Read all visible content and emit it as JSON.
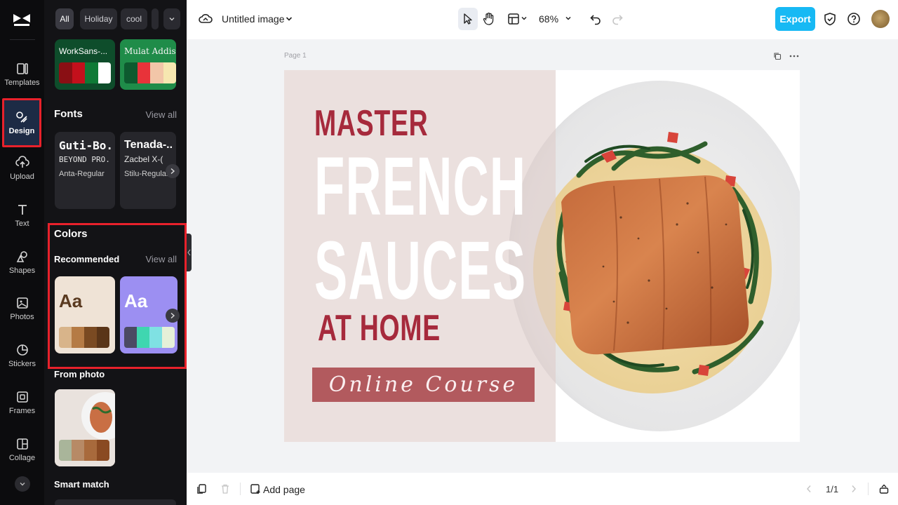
{
  "rail": {
    "items": [
      {
        "label": "Templates",
        "icon": "templates-icon"
      },
      {
        "label": "Design",
        "icon": "design-icon",
        "active": true
      },
      {
        "label": "Upload",
        "icon": "upload-icon"
      },
      {
        "label": "Text",
        "icon": "text-icon"
      },
      {
        "label": "Shapes",
        "icon": "shapes-icon"
      },
      {
        "label": "Photos",
        "icon": "photos-icon"
      },
      {
        "label": "Stickers",
        "icon": "stickers-icon"
      },
      {
        "label": "Frames",
        "icon": "frames-icon"
      },
      {
        "label": "Collage",
        "icon": "collage-icon"
      }
    ]
  },
  "panel": {
    "chips": [
      "All",
      "Holiday",
      "cool"
    ],
    "theme_cards": [
      {
        "font": "WorkSans-...",
        "bg": "#0e4d2b",
        "swatches": [
          "#8a0f14",
          "#c3101c",
          "#0f7a36",
          "#ffffff"
        ]
      },
      {
        "font": "Mulat Addis-...",
        "bg": "#1f8c49",
        "swatches": [
          "#0d5a2f",
          "#e8333a",
          "#f2c6a8",
          "#f6e7b0"
        ]
      }
    ],
    "fonts": {
      "title": "Fonts",
      "view_all": "View all",
      "cards": [
        {
          "big": "Guti-Bo...",
          "mid": "BEYOND PRO...",
          "small": "Anta-Regular"
        },
        {
          "big": "Tenada-...",
          "mid": "Zacbel X-(",
          "small": "Stilu-Regular"
        }
      ]
    },
    "colors": {
      "title": "Colors",
      "recommended": "Recommended",
      "view_all": "View all",
      "cards": [
        {
          "sample": "Aa",
          "bg": "#efe3d6",
          "text_color": "#5a3a20",
          "swatches": [
            "#d8b48a",
            "#b57b45",
            "#7a4a22",
            "#5a3518"
          ]
        },
        {
          "sample": "Aa",
          "bg": "#9c8ff2",
          "text_color": "#ffffff",
          "swatches": [
            "#4b4a63",
            "#3fd6b0",
            "#7fe1e3",
            "#e6f0d8"
          ]
        }
      ],
      "from_photo": "From photo",
      "photo_swatches": [
        "#a9b59a",
        "#b78a66",
        "#a86a3c",
        "#8a4a22"
      ],
      "smart_match": "Smart match"
    }
  },
  "topbar": {
    "title": "Untitled image",
    "zoom": "68%",
    "export": "Export"
  },
  "canvas": {
    "page_label": "Page 1",
    "design": {
      "line1": "MASTER",
      "line2": "FRENCH",
      "line3": "SAUCES",
      "line4": "AT HOME",
      "ribbon": "Online Course"
    }
  },
  "bottombar": {
    "add_page": "Add page",
    "page_count": "1/1"
  }
}
